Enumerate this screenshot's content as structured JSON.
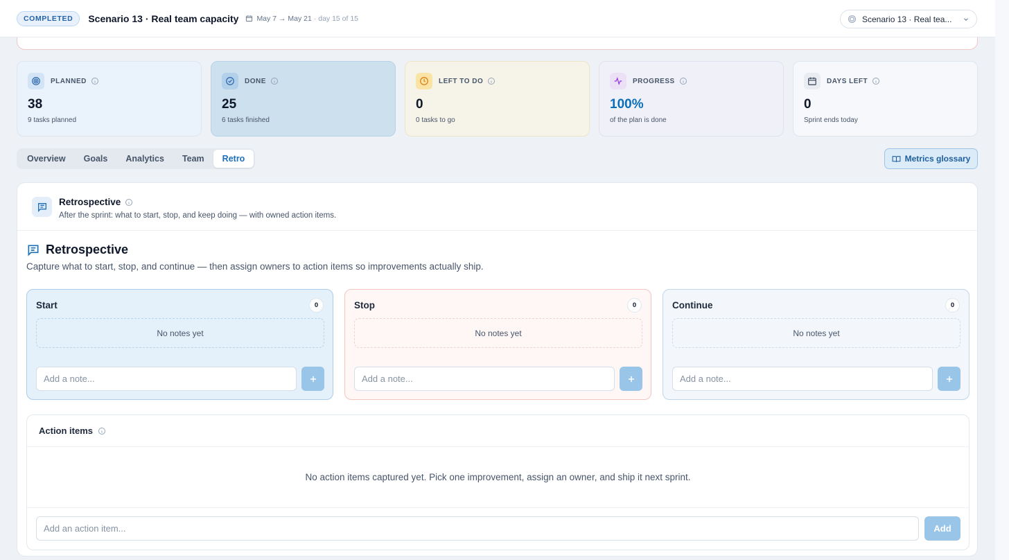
{
  "header": {
    "status": "COMPLETED",
    "title": "Scenario 13 · Real team capacity",
    "dates": "May 7 → May 21",
    "day_info": "· day 15 of 15",
    "scenario_selector": "Scenario 13 · Real tea..."
  },
  "stats": [
    {
      "label": "PLANNED",
      "value": "38",
      "sub": "9 tasks planned",
      "icon": "target-icon",
      "color": "#2563a8"
    },
    {
      "label": "DONE",
      "value": "25",
      "sub": "6 tasks finished",
      "icon": "check-circle-icon",
      "color": "#2563a8"
    },
    {
      "label": "LEFT TO DO",
      "value": "0",
      "sub": "0 tasks to go",
      "icon": "clock-icon",
      "color": "#d97706"
    },
    {
      "label": "PROGRESS",
      "value": "100%",
      "sub": "of the plan is done",
      "icon": "activity-icon",
      "color": "#0b6fb8"
    },
    {
      "label": "DAYS LEFT",
      "value": "0",
      "sub": "Sprint ends today",
      "icon": "calendar-icon",
      "color": "#0f172a"
    }
  ],
  "tabs": [
    "Overview",
    "Goals",
    "Analytics",
    "Team",
    "Retro"
  ],
  "active_tab": "Retro",
  "glossary_button": "Metrics glossary",
  "panel": {
    "title": "Retrospective",
    "subtitle": "After the sprint: what to start, stop, and keep doing — with owned action items."
  },
  "retro": {
    "title": "Retrospective",
    "description": "Capture what to start, stop, and continue — then assign owners to action items so improvements actually ship.",
    "columns": [
      {
        "title": "Start",
        "count": "0",
        "empty": "No notes yet",
        "placeholder": "Add a note..."
      },
      {
        "title": "Stop",
        "count": "0",
        "empty": "No notes yet",
        "placeholder": "Add a note..."
      },
      {
        "title": "Continue",
        "count": "0",
        "empty": "No notes yet",
        "placeholder": "Add a note..."
      }
    ]
  },
  "actions": {
    "title": "Action items",
    "empty": "No action items captured yet. Pick one improvement, assign an owner, and ship it next sprint.",
    "placeholder": "Add an action item...",
    "add_label": "Add"
  },
  "colors": {
    "accent": "#1d6fb8",
    "button_disabled": "#99c5e8"
  }
}
